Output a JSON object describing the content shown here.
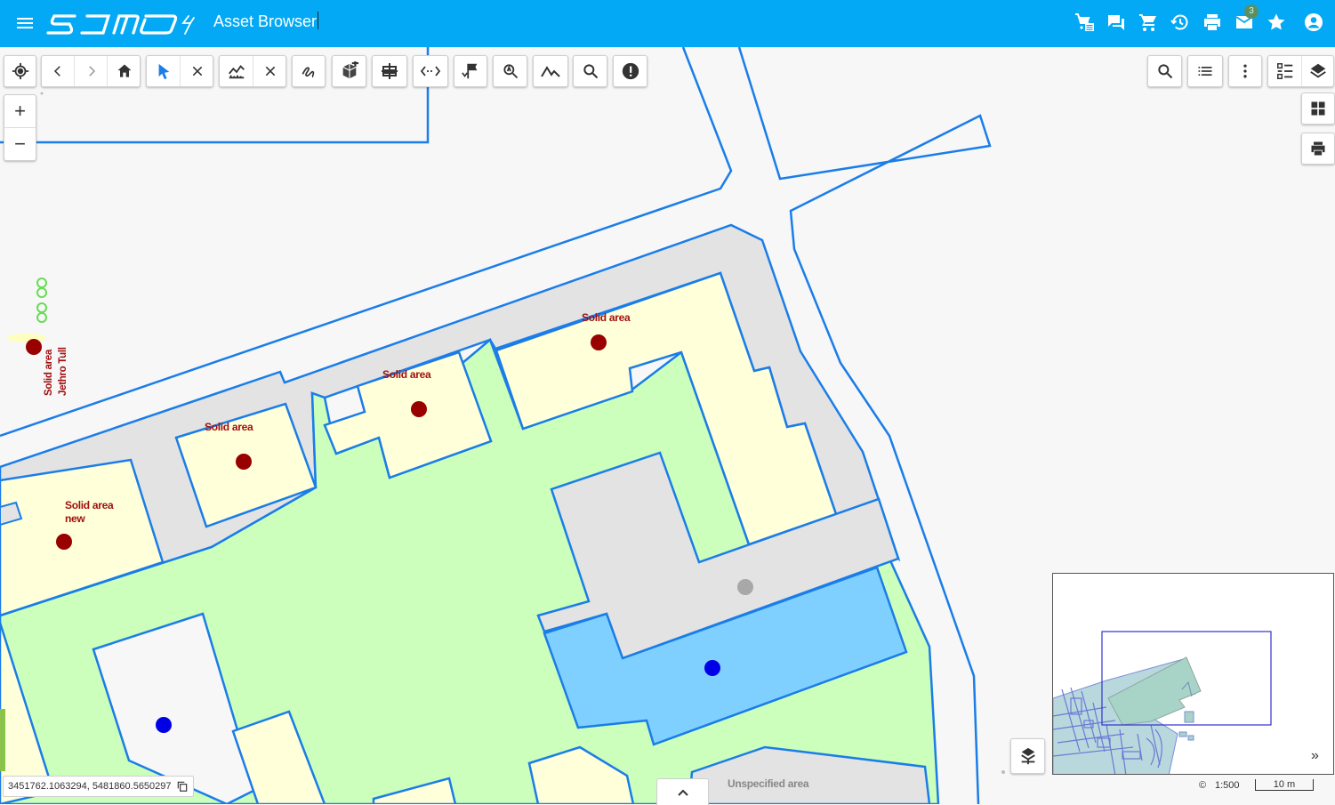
{
  "header": {
    "title": "Asset Browser",
    "background": "#03a9f4",
    "icons": [
      "menu-icon",
      "cart-list-icon",
      "chat-icon",
      "cart-icon",
      "history-icon",
      "print-icon",
      "mail-icon",
      "star-icon",
      "account-icon"
    ],
    "mail_badge": "3"
  },
  "toolbar": {
    "groups": [
      [
        "locate-icon"
      ],
      [
        "back-icon",
        "forward-icon",
        "home-icon"
      ],
      [
        "select-icon",
        "clear-select-icon"
      ],
      [
        "measure-icon",
        "clear-measure-icon"
      ],
      [
        "draw-icon"
      ],
      [
        "add-object-icon"
      ],
      [
        "split-icon"
      ],
      [
        "distance-icon"
      ],
      [
        "flag-icon"
      ],
      [
        "zoom-search-icon"
      ],
      [
        "profile-icon"
      ],
      [
        "search-icon"
      ],
      [
        "warning-icon"
      ]
    ],
    "right": [
      "search-icon",
      "list-icon",
      "more-icon",
      "legend-icon",
      "layers-icon"
    ],
    "side": [
      "grid-icon",
      "print-icon"
    ]
  },
  "zoom": {
    "in": "+",
    "out": "−"
  },
  "map": {
    "labels": {
      "solid1": "Solid area",
      "solid2": "Solid area",
      "solid3": "Solid area",
      "solid4": "Solid area",
      "solid_new_1": "Solid area",
      "solid_new_2": "new",
      "vertical_1": "Solid area",
      "vertical_2": "Jethro Tull",
      "unspecified": "Unspecified area"
    },
    "colors": {
      "area_green": "#ccffbb",
      "area_yellow": "#ffffd9",
      "area_gray": "#e3e3e3",
      "area_blue": "#80d0ff",
      "outline": "#1a7de8",
      "point_red": "#990000",
      "point_blue": "#0000e6",
      "point_gray": "#a8a8a8"
    }
  },
  "coordinates": "3451762.1063294, 5481860.5650297",
  "scale": {
    "ratio": "1:500",
    "bar": "10 m",
    "copyright": "©"
  },
  "overview_toggle": "»",
  "collapse": "^"
}
